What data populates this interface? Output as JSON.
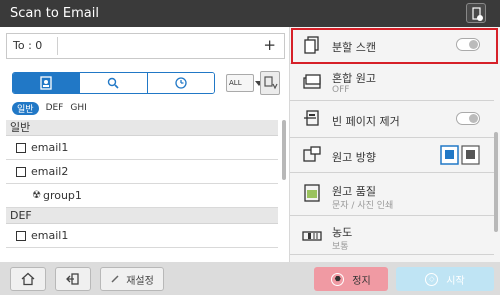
{
  "window": {
    "title": "Scan to Email"
  },
  "to": {
    "label": "To : 0",
    "add": "+"
  },
  "search_tabs": {
    "all_label": "ALL"
  },
  "index_tabs": [
    "일반",
    "DEF",
    "GHI"
  ],
  "list": {
    "sections": [
      {
        "header": "일반",
        "items": [
          "email1",
          "email2"
        ],
        "group": "group1"
      },
      {
        "header": "DEF",
        "items": [
          "email1"
        ]
      }
    ]
  },
  "options": [
    {
      "label": "분할 스캔",
      "sub": ""
    },
    {
      "label": "혼합 원고",
      "sub": "OFF"
    },
    {
      "label": "빈 페이지 제거",
      "sub": ""
    },
    {
      "label": "원고 방향",
      "sub": ""
    },
    {
      "label": "원고 품질",
      "sub": "문자 / 사진 인쇄"
    },
    {
      "label": "농도",
      "sub": "보통"
    }
  ],
  "bottom": {
    "reset_label": "재설정",
    "stop_label": "정지",
    "start_label": "시작"
  },
  "colors": {
    "accent": "#2178c6",
    "highlight": "#d62028",
    "stop": "#f09aa3",
    "start": "#bfe4f4"
  }
}
